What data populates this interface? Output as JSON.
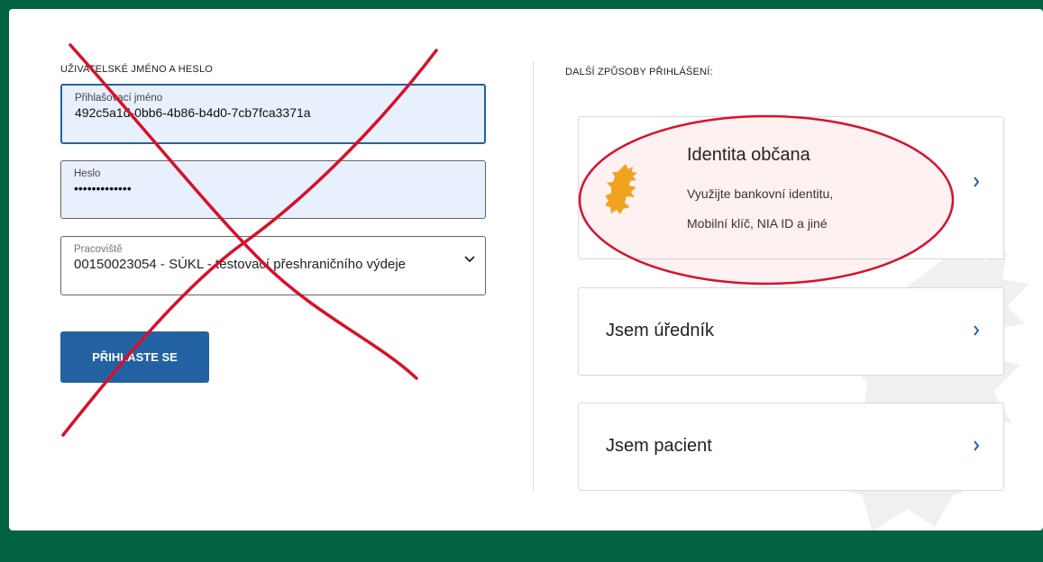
{
  "login_form": {
    "section_label": "UŽIVATELSKÉ JMÉNO A HESLO",
    "username": {
      "label": "Přihlašovací jméno",
      "value": "492c5a1d-0bb6-4b86-b4d0-7cb7fca3371a"
    },
    "password": {
      "label": "Heslo",
      "value": "•••••••••••••"
    },
    "workplace": {
      "label": "Pracoviště",
      "value": "00150023054 - SÚKL - testovací přeshraničního výdeje"
    },
    "submit_label": "PŘIHLASTE SE"
  },
  "other_methods": {
    "section_label": "DALŠÍ ZPŮSOBY PŘIHLÁŠENÍ:",
    "options": [
      {
        "title": "Identita občana",
        "desc_line1": "Využijte bankovní identitu,",
        "desc_line2": "Mobilní klíč, NIA ID a jiné",
        "icon": "czech-lion-icon"
      },
      {
        "title": "Jsem úředník"
      },
      {
        "title": "Jsem pacient"
      }
    ]
  },
  "colors": {
    "background": "#046342",
    "primary_button": "#2362a2",
    "annotation_red": "#d8102a"
  }
}
